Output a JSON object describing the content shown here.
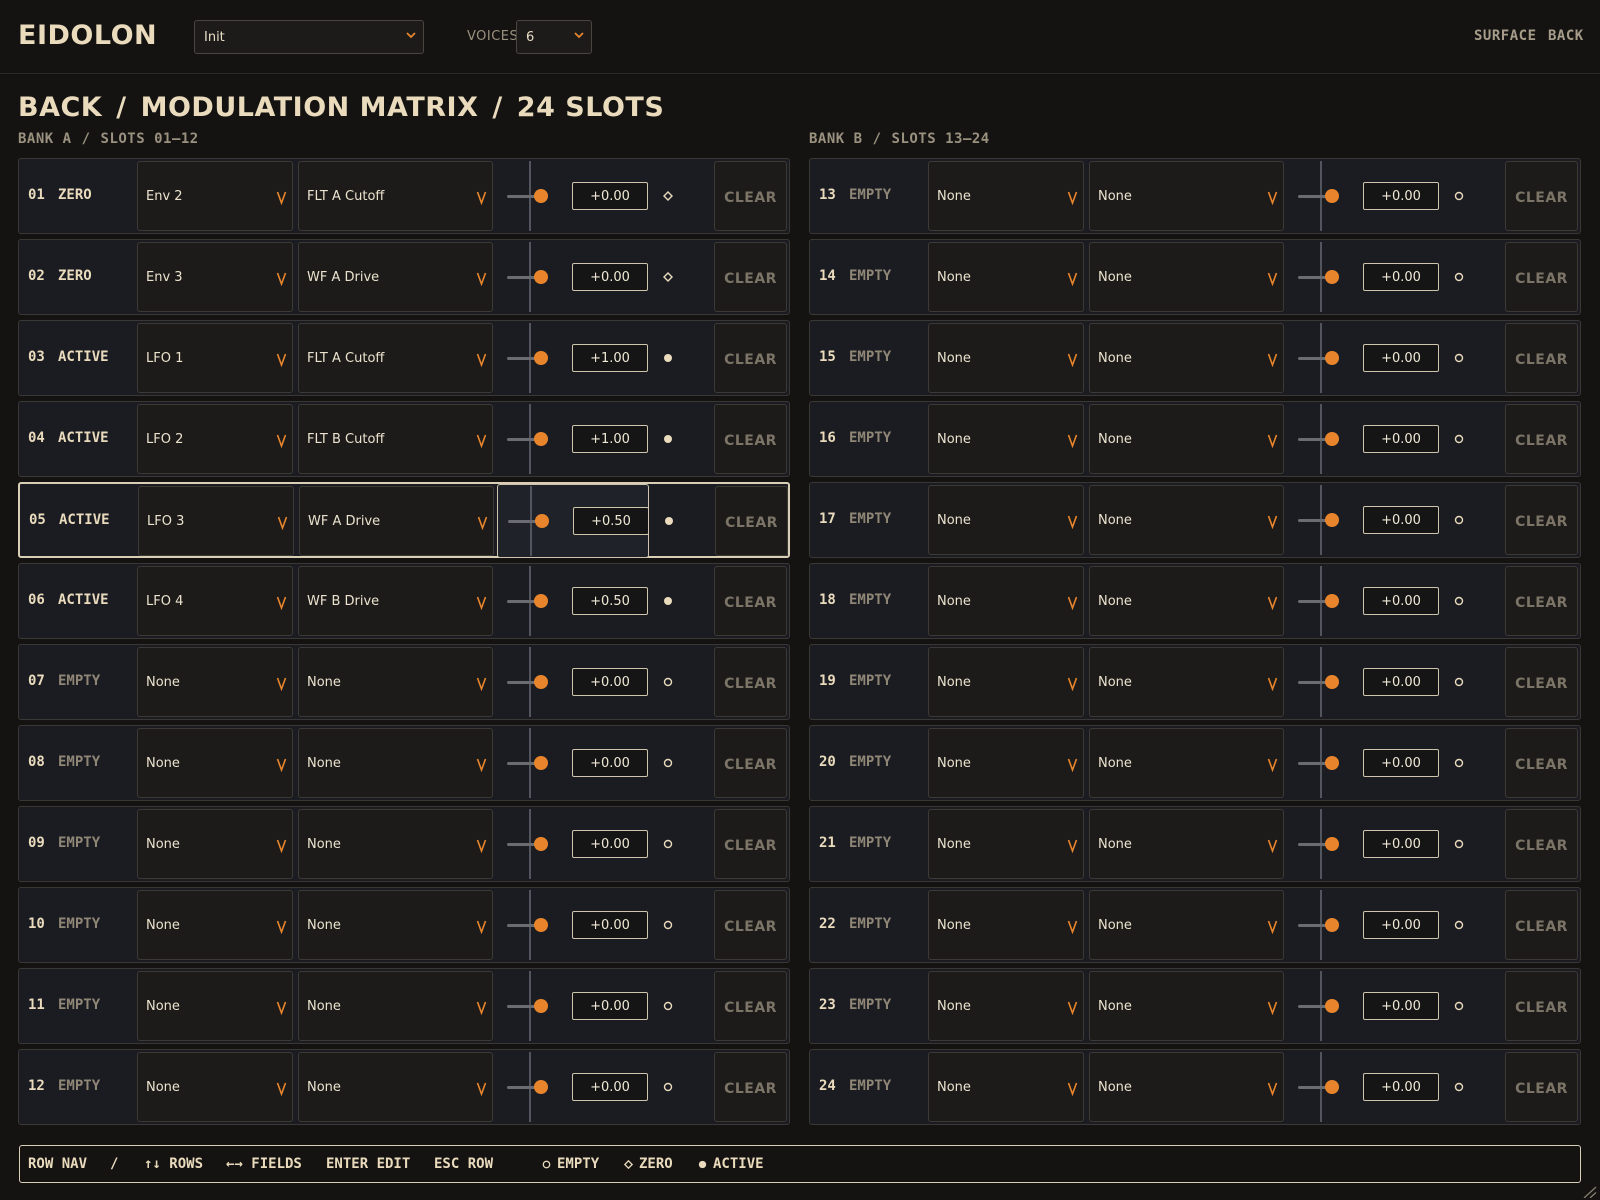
{
  "app": {
    "name": "EIDOLON",
    "preset": "Init",
    "voices_label": "VOICES",
    "voices": "6",
    "nav": [
      "SURFACE",
      "BACK"
    ]
  },
  "breadcrumb": [
    "BACK",
    "MODULATION MATRIX",
    "24 SLOTS"
  ],
  "separator": "/",
  "banks": [
    {
      "name": "BANK A",
      "range": "SLOTS 01–12"
    },
    {
      "name": "BANK B",
      "range": "SLOTS 13–24"
    }
  ],
  "clear_label": "CLEAR",
  "colors": {
    "accent": "#e8852c",
    "text": "#eadbbd",
    "focus": "#d9cfb6"
  },
  "slots": [
    {
      "num": "01",
      "state": "ZERO",
      "source": "Env 2",
      "dest": "FLT A Cutoff",
      "amount": "+0.00",
      "status": "zero"
    },
    {
      "num": "02",
      "state": "ZERO",
      "source": "Env 3",
      "dest": "WF A Drive",
      "amount": "+0.00",
      "status": "zero"
    },
    {
      "num": "03",
      "state": "ACTIVE",
      "source": "LFO 1",
      "dest": "FLT A Cutoff",
      "amount": "+1.00",
      "status": "active"
    },
    {
      "num": "04",
      "state": "ACTIVE",
      "source": "LFO 2",
      "dest": "FLT B Cutoff",
      "amount": "+1.00",
      "status": "active"
    },
    {
      "num": "05",
      "state": "ACTIVE",
      "source": "LFO 3",
      "dest": "WF A Drive",
      "amount": "+0.50",
      "status": "active",
      "focused": true
    },
    {
      "num": "06",
      "state": "ACTIVE",
      "source": "LFO 4",
      "dest": "WF B Drive",
      "amount": "+0.50",
      "status": "active"
    },
    {
      "num": "07",
      "state": "EMPTY",
      "source": "None",
      "dest": "None",
      "amount": "+0.00",
      "status": "empty"
    },
    {
      "num": "08",
      "state": "EMPTY",
      "source": "None",
      "dest": "None",
      "amount": "+0.00",
      "status": "empty"
    },
    {
      "num": "09",
      "state": "EMPTY",
      "source": "None",
      "dest": "None",
      "amount": "+0.00",
      "status": "empty"
    },
    {
      "num": "10",
      "state": "EMPTY",
      "source": "None",
      "dest": "None",
      "amount": "+0.00",
      "status": "empty"
    },
    {
      "num": "11",
      "state": "EMPTY",
      "source": "None",
      "dest": "None",
      "amount": "+0.00",
      "status": "empty"
    },
    {
      "num": "12",
      "state": "EMPTY",
      "source": "None",
      "dest": "None",
      "amount": "+0.00",
      "status": "empty"
    },
    {
      "num": "13",
      "state": "EMPTY",
      "source": "None",
      "dest": "None",
      "amount": "+0.00",
      "status": "empty"
    },
    {
      "num": "14",
      "state": "EMPTY",
      "source": "None",
      "dest": "None",
      "amount": "+0.00",
      "status": "empty"
    },
    {
      "num": "15",
      "state": "EMPTY",
      "source": "None",
      "dest": "None",
      "amount": "+0.00",
      "status": "empty"
    },
    {
      "num": "16",
      "state": "EMPTY",
      "source": "None",
      "dest": "None",
      "amount": "+0.00",
      "status": "empty"
    },
    {
      "num": "17",
      "state": "EMPTY",
      "source": "None",
      "dest": "None",
      "amount": "+0.00",
      "status": "empty"
    },
    {
      "num": "18",
      "state": "EMPTY",
      "source": "None",
      "dest": "None",
      "amount": "+0.00",
      "status": "empty"
    },
    {
      "num": "19",
      "state": "EMPTY",
      "source": "None",
      "dest": "None",
      "amount": "+0.00",
      "status": "empty"
    },
    {
      "num": "20",
      "state": "EMPTY",
      "source": "None",
      "dest": "None",
      "amount": "+0.00",
      "status": "empty"
    },
    {
      "num": "21",
      "state": "EMPTY",
      "source": "None",
      "dest": "None",
      "amount": "+0.00",
      "status": "empty"
    },
    {
      "num": "22",
      "state": "EMPTY",
      "source": "None",
      "dest": "None",
      "amount": "+0.00",
      "status": "empty"
    },
    {
      "num": "23",
      "state": "EMPTY",
      "source": "None",
      "dest": "None",
      "amount": "+0.00",
      "status": "empty"
    },
    {
      "num": "24",
      "state": "EMPTY",
      "source": "None",
      "dest": "None",
      "amount": "+0.00",
      "status": "empty"
    }
  ],
  "footer": {
    "row_nav": "ROW NAV",
    "rows": "↑↓ ROWS",
    "fields": "←→ FIELDS",
    "enter": "ENTER EDIT",
    "esc": "ESC ROW",
    "legend": {
      "empty": "EMPTY",
      "zero": "ZERO",
      "active": "ACTIVE"
    }
  }
}
